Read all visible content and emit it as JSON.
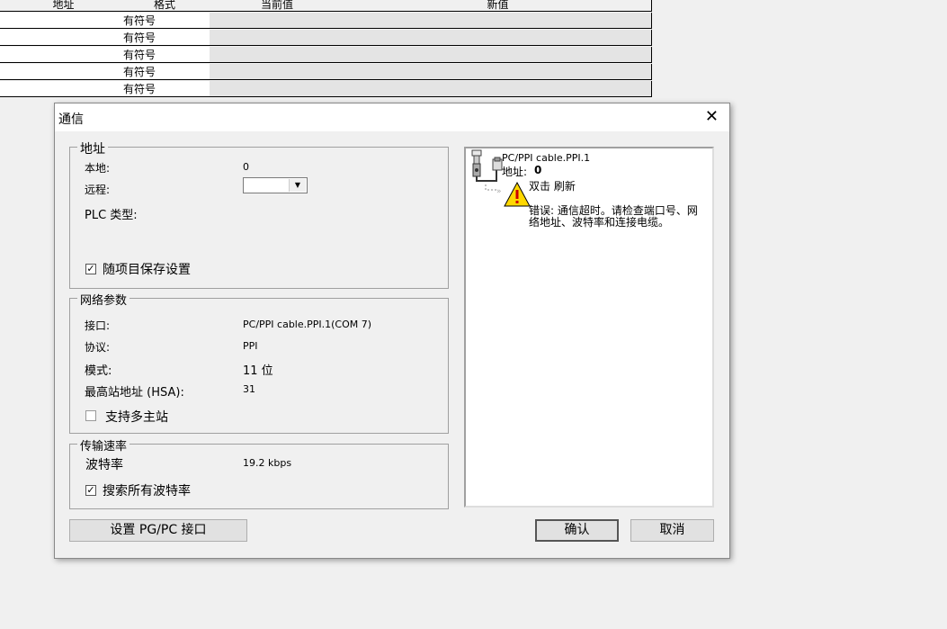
{
  "table": {
    "headers": [
      "地址",
      "格式",
      "当前值",
      "新值"
    ],
    "rows": [
      {
        "format": "有符号"
      },
      {
        "format": "有符号"
      },
      {
        "format": "有符号"
      },
      {
        "format": "有符号"
      },
      {
        "format": "有符号"
      }
    ]
  },
  "dialog": {
    "title": "通信",
    "address_group": {
      "legend": "地址",
      "local_label": "本地:",
      "local_value": "0",
      "remote_label": "远程:",
      "remote_value": "",
      "plc_type_label": "PLC 类型:",
      "save_with_project_label": "随项目保存设置",
      "save_with_project_checked": true
    },
    "network_group": {
      "legend": "网络参数",
      "interface_label": "接口:",
      "interface_value": "PC/PPI cable.PPI.1(COM 7)",
      "protocol_label": "协议:",
      "protocol_value": "PPI",
      "mode_label": "模式:",
      "mode_value": "11 位",
      "hsa_label": "最高站地址 (HSA):",
      "hsa_value": "31",
      "multi_master_label": "支持多主站",
      "multi_master_checked": false
    },
    "baud_group": {
      "legend": "传输速率",
      "baud_label": "波特率",
      "baud_value": "19.2 kbps",
      "search_all_label": "搜索所有波特率",
      "search_all_checked": true
    },
    "network_panel": {
      "cable_name": "PC/PPI cable.PPI.1",
      "address_label": "地址:",
      "address_value": "0",
      "refresh_hint": "双击 刷新",
      "error_line1": "错误: 通信超时。请检查端口号、网",
      "error_line2": "络地址、波特率和连接电缆。"
    },
    "buttons": {
      "set_pgpc": "设置 PG/PC 接口",
      "ok": "确认",
      "cancel": "取消"
    }
  },
  "icons": {
    "close": "close-icon",
    "cable": "pc-ppi-cable-icon",
    "warning": "warning-icon",
    "dropdown": "chevron-down-icon"
  },
  "colors": {
    "warning_fill": "#ffd800",
    "table_readonly": "#e4e4e4"
  }
}
